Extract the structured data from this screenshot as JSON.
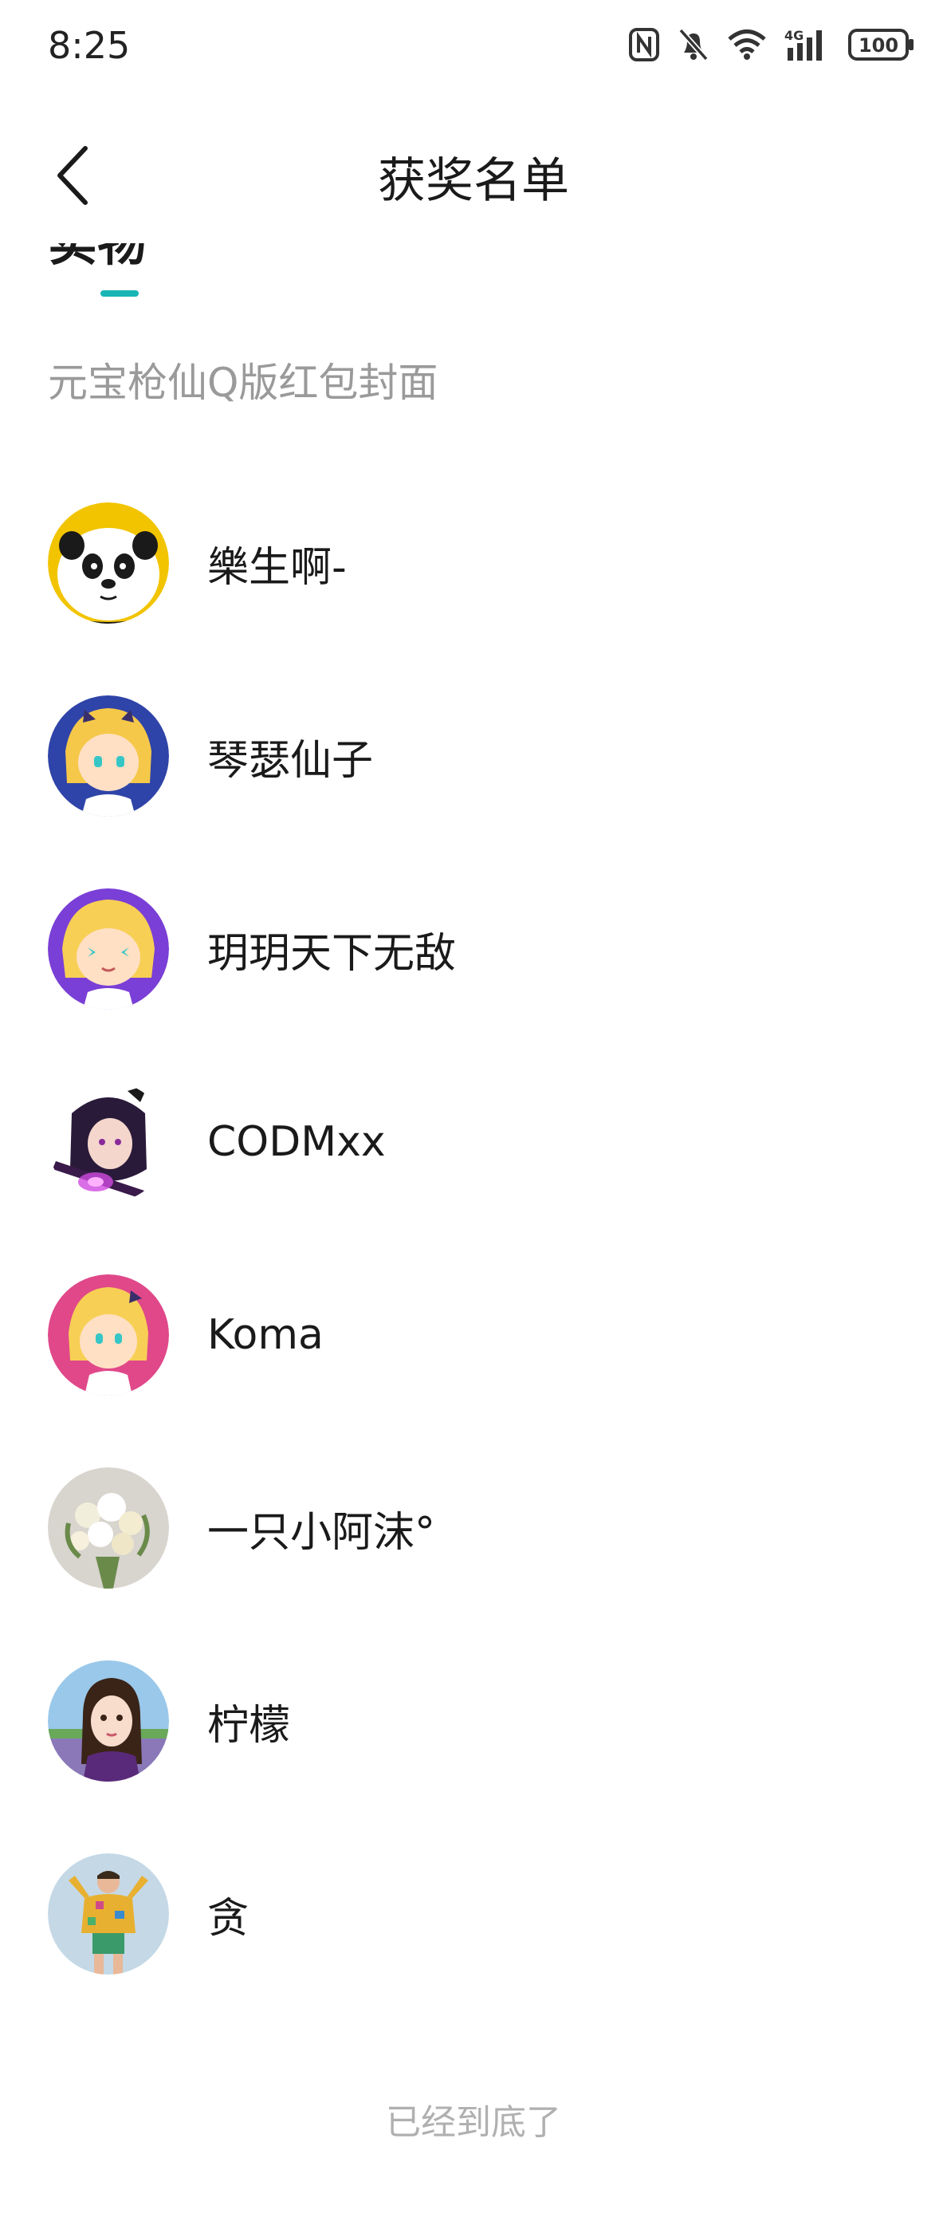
{
  "status_bar": {
    "time": "8:25",
    "battery": "100",
    "network": "4G",
    "icons": [
      "nfc-icon",
      "mute-bell-icon",
      "wifi-icon",
      "4g-signal-icon",
      "battery-icon"
    ]
  },
  "header": {
    "title": "获奖名单",
    "back_icon": "chevron-left-icon"
  },
  "tab": {
    "label": "实物",
    "indicator_color": "#19b5b5"
  },
  "section": {
    "label": "元宝枪仙Q版红包封面"
  },
  "winners": [
    {
      "name": "樂生啊-",
      "avatar": "panda-avatar"
    },
    {
      "name": "琴瑟仙子",
      "avatar": "cartoon-girl-blue-avatar"
    },
    {
      "name": "玥玥天下无敌",
      "avatar": "cartoon-girl-purple-avatar"
    },
    {
      "name": "CODMxx",
      "avatar": "anime-warrior-avatar"
    },
    {
      "name": "Koma",
      "avatar": "cartoon-girl-pink-avatar"
    },
    {
      "name": "一只小阿沫°",
      "avatar": "flower-bouquet-avatar"
    },
    {
      "name": "柠檬",
      "avatar": "girl-portrait-avatar"
    },
    {
      "name": "贪",
      "avatar": "boy-figure-avatar"
    }
  ],
  "footer": {
    "end_text": "已经到底了"
  }
}
